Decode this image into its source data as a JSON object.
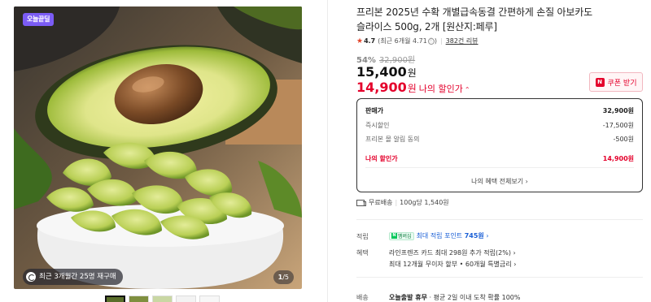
{
  "gallery": {
    "badge": "오늘끝딜",
    "rebuy_text": "최근 3개월간 25명 재구매",
    "counter_current": "1",
    "counter_total": "/5",
    "thumbnail_count": 5
  },
  "product": {
    "title_line1": "프리본 2025년 수확 개별급속동결 간편하게 손질 아보카도",
    "title_line2": "슬라이스 500g, 2개 [원산지:페루]",
    "rating": "4.7",
    "rating_detail": "(최근 6개월 4.71",
    "rating_info_icon": "ⓘ",
    "rating_close": ")",
    "review_count": "382건 리뷰"
  },
  "price": {
    "discount_rate": "54%",
    "original": "32,900원",
    "sale": "15,400",
    "sale_unit": "원",
    "my_price": "14,900",
    "my_price_unit": "원",
    "my_price_label": "나의 할인가",
    "coupon_label": "쿠폰 받기",
    "coupon_icon": "N"
  },
  "breakdown": {
    "rows": [
      {
        "label": "판매가",
        "value": "32,900원"
      },
      {
        "label": "즉시할인",
        "value": "-17,500원"
      },
      {
        "label": "프리본 몰 알림 동의",
        "value": "-500원"
      },
      {
        "label": "나의 할인가",
        "value": "14,900원"
      }
    ],
    "more_label": "나의 혜택 전체보기"
  },
  "shipping": {
    "label": "무료배송",
    "unit_price": "100g당 1,540원"
  },
  "details": {
    "points_label": "적립",
    "npay_label": "멤버십",
    "points_text": "최대 적립 포인트",
    "points_value": "745원",
    "benefit_label": "혜택",
    "benefit_line1": "라인프렌즈 카드 최대 298원 추가 적립(2%)",
    "benefit_line2": "최대 12개월 무이자 할부 • 60개월 특별금리",
    "delivery_label": "배송",
    "delivery_bold": "오늘출발 휴무",
    "delivery_rest": "· 평균 2일 이내 도착 확률 100%"
  },
  "colors": {
    "accent_red": "#e4002b",
    "badge_purple": "#7b5cf5",
    "npay_green": "#03c75a"
  }
}
